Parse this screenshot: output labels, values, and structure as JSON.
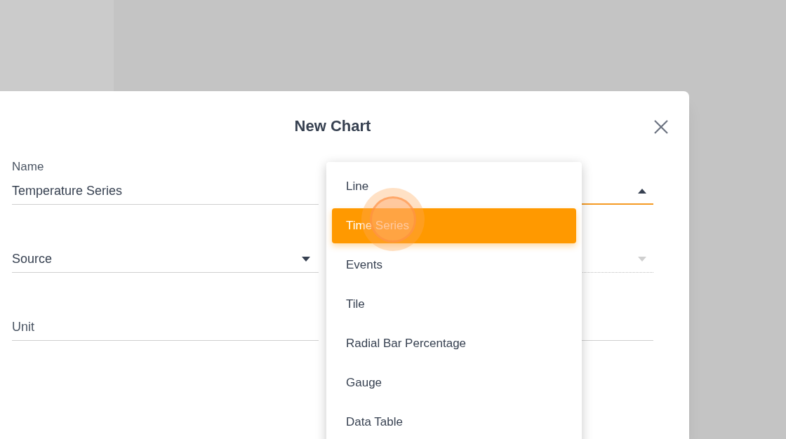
{
  "dialog": {
    "title": "New Chart"
  },
  "left_fields": [
    {
      "kind": "text",
      "label": "Name",
      "value": "Temperature Series"
    },
    {
      "kind": "select",
      "placeholder": "Source",
      "disabled": false
    },
    {
      "kind": "text",
      "placeholder": "Unit"
    }
  ],
  "right_fields": [
    {
      "kind": "select",
      "expanded": true,
      "disabled": false
    },
    {
      "kind": "select",
      "expanded": false,
      "disabled": true
    },
    {
      "kind": "text"
    }
  ],
  "menu": {
    "items": [
      {
        "label": "Line",
        "selected": false
      },
      {
        "label": "Time Series",
        "selected": true
      },
      {
        "label": "Events",
        "selected": false
      },
      {
        "label": "Tile",
        "selected": false
      },
      {
        "label": "Radial Bar Percentage",
        "selected": false
      },
      {
        "label": "Gauge",
        "selected": false
      },
      {
        "label": "Data Table",
        "selected": false
      }
    ]
  }
}
